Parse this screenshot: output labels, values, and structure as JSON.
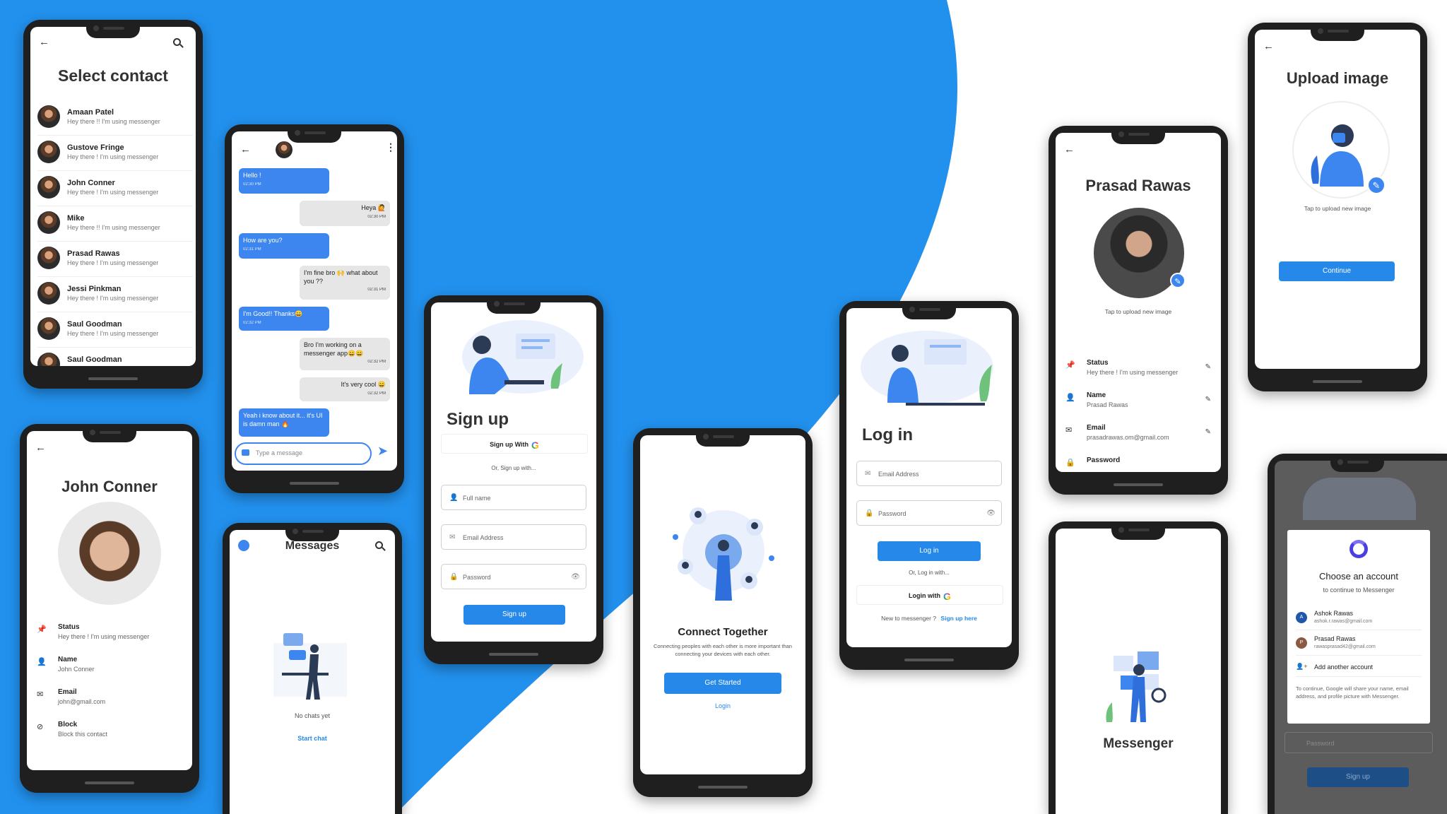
{
  "colors": {
    "brand_blue": "#2291ee",
    "button_blue": "#2689ea",
    "bubble_blue": "#3d86f0",
    "phone_frame": "#1f1f1f"
  },
  "select_contact": {
    "title": "Select contact",
    "contacts": [
      {
        "name": "Amaan Patel",
        "status": "Hey there !! I'm using messenger"
      },
      {
        "name": "Gustove Fringe",
        "status": "Hey there ! I'm using messenger"
      },
      {
        "name": "John Conner",
        "status": "Hey there ! I'm using messenger"
      },
      {
        "name": "Mike",
        "status": "Hey there !! I'm using messenger"
      },
      {
        "name": "Prasad Rawas",
        "status": "Hey there ! I'm using messenger"
      },
      {
        "name": "Jessi Pinkman",
        "status": "Hey there ! I'm using messenger"
      },
      {
        "name": "Saul Goodman",
        "status": "Hey there ! I'm using messenger"
      },
      {
        "name": "Saul Goodman",
        "status": ""
      }
    ]
  },
  "chat": {
    "messages": [
      {
        "text": "Hello !",
        "time": "02:30 PM",
        "dir": "out"
      },
      {
        "text": "Heya 🙋",
        "time": "02:30 PM",
        "dir": "in"
      },
      {
        "text": "How are you?",
        "time": "02:31 PM",
        "dir": "out"
      },
      {
        "text": "I'm fine bro 🙌 what about you ??",
        "time": "02:31 PM",
        "dir": "in"
      },
      {
        "text": "I'm Good!! Thanks😀",
        "time": "02:32 PM",
        "dir": "out"
      },
      {
        "text": "Bro I'm working on a messenger app😄😄",
        "time": "02:32 PM",
        "dir": "in"
      },
      {
        "text": "It's very cool 😄",
        "time": "02:32 PM",
        "dir": "in"
      },
      {
        "text": "Yeah i know about it... it's UI is damn man 🔥",
        "time": "",
        "dir": "out"
      }
    ],
    "input_placeholder": "Type a message"
  },
  "sign_up": {
    "title": "Sign up",
    "google_button": "Sign up With",
    "or_text": "Or, Sign up with...",
    "fields": {
      "full_name": "Full name",
      "email": "Email Address",
      "password": "Password"
    },
    "submit": "Sign up"
  },
  "connect": {
    "title": "Connect Together",
    "description": "Connecting peoples with each other is more important than connecting your devices with each other.",
    "get_started": "Get Started",
    "login_link": "Login"
  },
  "log_in": {
    "title": "Log in",
    "fields": {
      "email": "Email Address",
      "password": "Password"
    },
    "submit": "Log in",
    "or_text": "Or, Log in with...",
    "google_button": "Login with",
    "new_text": "New to messenger ?",
    "signup_link": "Sign up here"
  },
  "profile_prasad": {
    "name": "Prasad Rawas",
    "tap_text": "Tap to upload new image",
    "rows": [
      {
        "label": "Status",
        "value": "Hey there ! I'm using messenger"
      },
      {
        "label": "Name",
        "value": "Prasad Rawas"
      },
      {
        "label": "Email",
        "value": "prasadrawas.om@gmail.com"
      },
      {
        "label": "Password",
        "value": ""
      }
    ]
  },
  "upload_image": {
    "title": "Upload image",
    "tap_text": "Tap to upload new image",
    "continue": "Continue"
  },
  "profile_john": {
    "name": "John Conner",
    "rows": [
      {
        "label": "Status",
        "value": "Hey there ! I'm using messenger"
      },
      {
        "label": "Name",
        "value": "John Conner"
      },
      {
        "label": "Email",
        "value": "john@gmail.com"
      },
      {
        "label": "Block",
        "value": "Block this contact"
      }
    ]
  },
  "messages_empty": {
    "title": "Messages",
    "empty_text": "No chats yet",
    "start_chat": "Start chat"
  },
  "splash": {
    "app_name": "Messenger"
  },
  "choose_account": {
    "title": "Choose an account",
    "subtitle": "to continue to Messenger",
    "accounts": [
      {
        "initial": "A",
        "name": "Ashok Rawas",
        "email": "ashok.r.rawas@gmail.com"
      },
      {
        "initial": "P",
        "name": "Prasad Rawas",
        "email": "rawasprasad42@gmail.com"
      }
    ],
    "add_account": "Add another account",
    "notice": "To continue, Google will share your name, email address, and profile picture with Messenger.",
    "bg_password": "Password",
    "bg_signup": "Sign up"
  }
}
